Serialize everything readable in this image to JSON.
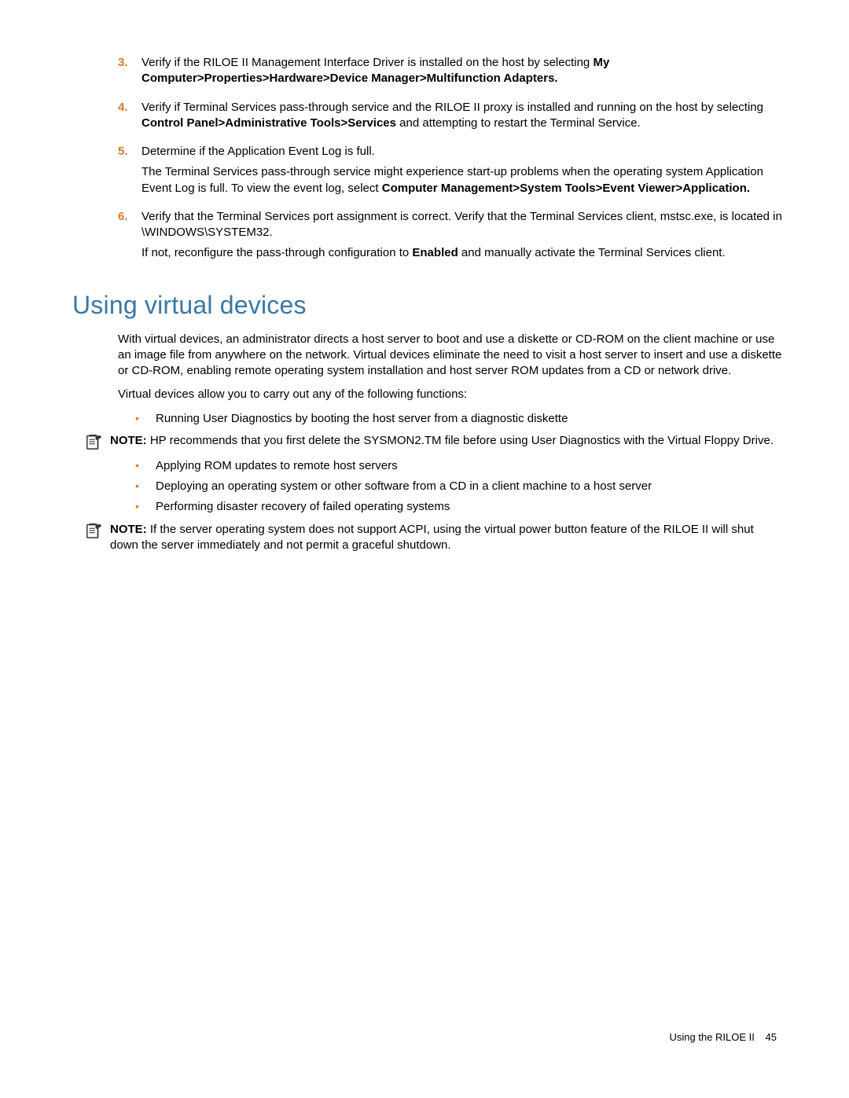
{
  "steps": {
    "s3": {
      "num": "3.",
      "line1a": "Verify if the RILOE II Management Interface Driver is installed on the host by selecting ",
      "line1b": "My Computer>Properties>Hardware>Device Manager>Multifunction Adapters."
    },
    "s4": {
      "num": "4.",
      "line1a": "Verify if Terminal Services pass-through service and the RILOE II proxy is installed and running on the host by selecting ",
      "line1b": "Control Panel>Administrative Tools>Services",
      "line1c": " and attempting to restart the Terminal Service."
    },
    "s5": {
      "num": "5.",
      "line1": "Determine if the Application Event Log is full.",
      "line2a": "The Terminal Services pass-through service might experience start-up problems when the operating system Application Event Log is full. To view the event log, select ",
      "line2b": "Computer Management>System Tools>Event Viewer>Application."
    },
    "s6": {
      "num": "6.",
      "line1": "Verify that the Terminal Services port assignment is correct. Verify that the Terminal Services client, mstsc.exe, is located in \\WINDOWS\\SYSTEM32.",
      "line2a": "If not, reconfigure the pass-through configuration to ",
      "line2b": "Enabled",
      "line2c": " and manually activate the Terminal Services client."
    }
  },
  "heading": "Using virtual devices",
  "intro": {
    "p1": "With virtual devices, an administrator directs a host server to boot and use a diskette or CD-ROM on the client machine or use an image file from anywhere on the network. Virtual devices eliminate the need to visit a host server to insert and use a diskette or CD-ROM, enabling remote operating system installation and host server ROM updates from a CD or network drive.",
    "p2": "Virtual devices allow you to carry out any of the following functions:"
  },
  "bullets1": {
    "b1": "Running User Diagnostics by booting the host server from a diagnostic diskette"
  },
  "note1": {
    "label": "NOTE:",
    "text": "  HP recommends that you first delete the SYSMON2.TM file before using User Diagnostics with the Virtual Floppy Drive."
  },
  "bullets2": {
    "b1": "Applying ROM updates to remote host servers",
    "b2": "Deploying an operating system or other software from a CD in a client machine to a host server",
    "b3": "Performing disaster recovery of failed operating systems"
  },
  "note2": {
    "label": "NOTE:",
    "text": "  If the server operating system does not support ACPI, using the virtual power button feature of the RILOE II will shut down the server immediately and not permit a graceful shutdown."
  },
  "footer": {
    "title": "Using the RILOE II",
    "page": "45"
  },
  "dot": "•"
}
